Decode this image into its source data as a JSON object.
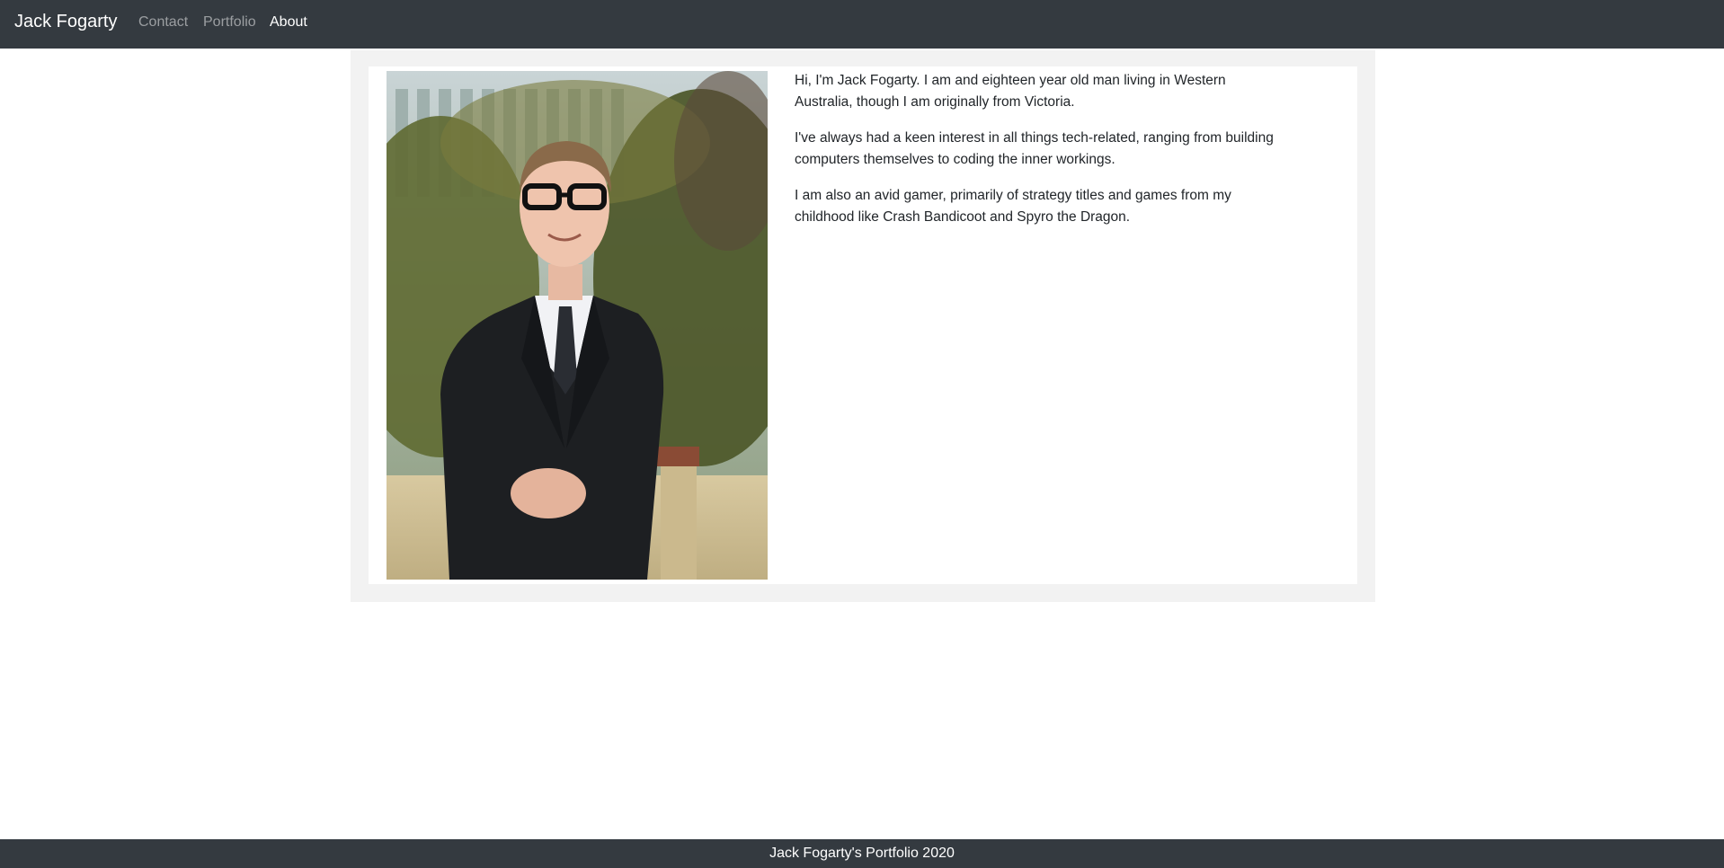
{
  "navbar": {
    "brand": "Jack Fogarty",
    "links": [
      {
        "label": "Contact",
        "active": false
      },
      {
        "label": "Portfolio",
        "active": false
      },
      {
        "label": "About",
        "active": true
      }
    ]
  },
  "about": {
    "photo_icon": "portrait-photo",
    "paragraphs": [
      "Hi, I'm Jack Fogarty. I am and eighteen year old man living in Western Australia, though I am originally from Victoria.",
      "I've always had a keen interest in all things tech-related, ranging from building computers themselves to coding the inner workings.",
      "I am also an avid gamer, primarily of strategy titles and games from my childhood like Crash Bandicoot and Spyro the Dragon."
    ]
  },
  "footer": {
    "text": "Jack Fogarty's Portfolio 2020"
  },
  "colors": {
    "navbar_bg": "#343a40",
    "panel_bg": "#f2f2f2",
    "text": "#212529"
  }
}
